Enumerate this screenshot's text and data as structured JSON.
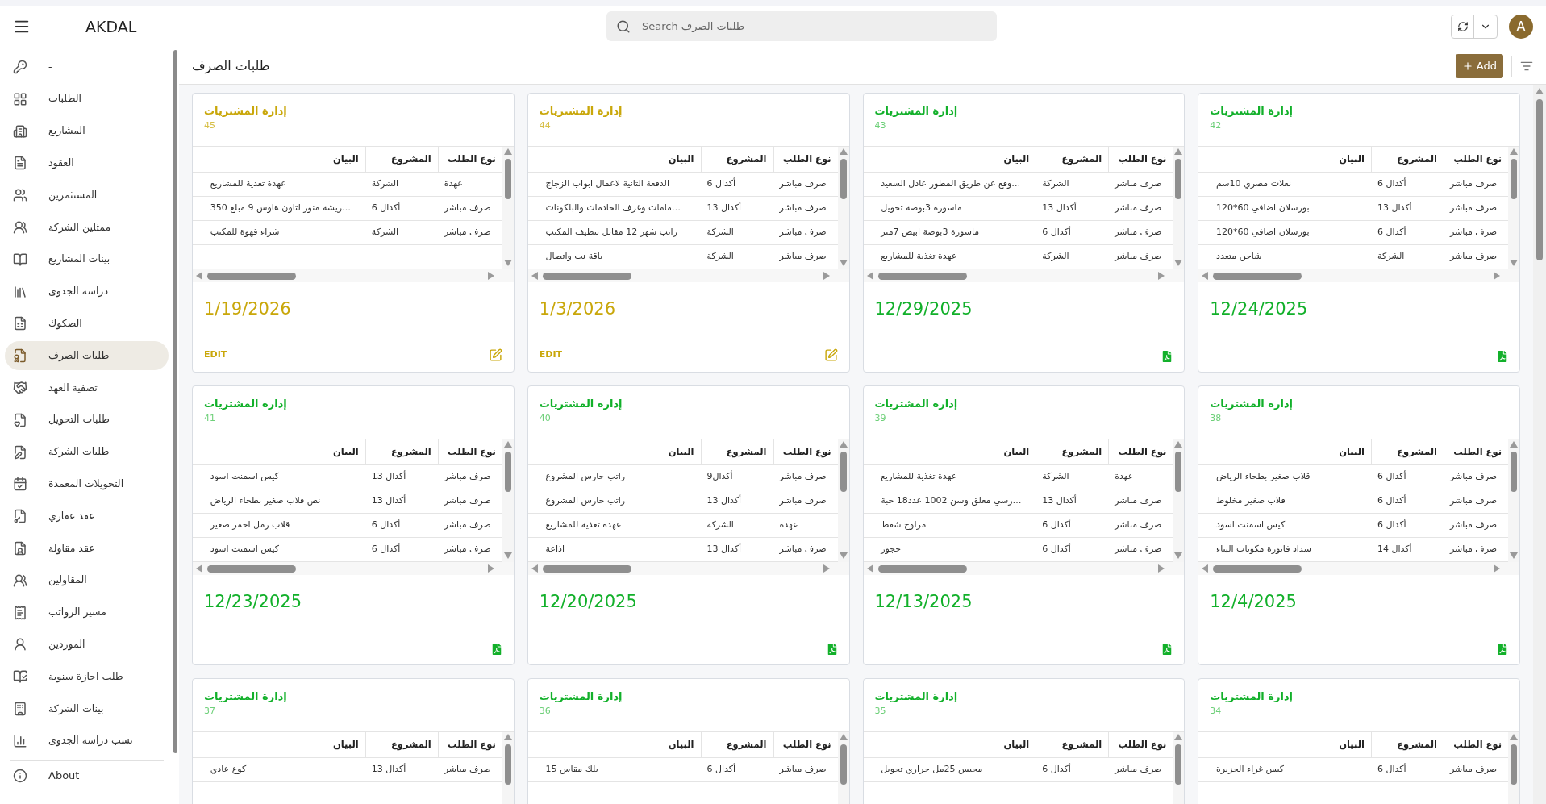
{
  "header": {
    "app_name": "AKDAL",
    "search": {
      "placeholder": "Search طلبات الصرف"
    },
    "avatar": "A"
  },
  "sidebar": {
    "items": [
      {
        "label": "-",
        "selected": false
      },
      {
        "label": "الطلبات",
        "selected": false
      },
      {
        "label": "المشاريع",
        "selected": false
      },
      {
        "label": "العقود",
        "selected": false
      },
      {
        "label": "المستثمرين",
        "selected": false
      },
      {
        "label": "ممثلين الشركة",
        "selected": false
      },
      {
        "label": "بينات المشاريع",
        "selected": false
      },
      {
        "label": "دراسة الجدوى",
        "selected": false
      },
      {
        "label": "الصكوك",
        "selected": false
      },
      {
        "label": "طلبات الصرف",
        "selected": true
      },
      {
        "label": "تصفية العهد",
        "selected": false
      },
      {
        "label": "طلبات التحويل",
        "selected": false
      },
      {
        "label": "طلبات الشركة",
        "selected": false
      },
      {
        "label": "التحويلات المعمدة",
        "selected": false
      },
      {
        "label": "عقد عقاري",
        "selected": false
      },
      {
        "label": "عقد مقاولة",
        "selected": false
      },
      {
        "label": "المقاولين",
        "selected": false
      },
      {
        "label": "مسير الرواتب",
        "selected": false
      },
      {
        "label": "الموردين",
        "selected": false
      },
      {
        "label": "طلب اجازة سنوية",
        "selected": false
      },
      {
        "label": "بينات الشركة",
        "selected": false
      },
      {
        "label": "نسب دراسة الجدوى",
        "selected": false
      }
    ],
    "footer_items": [
      {
        "label": "About"
      }
    ]
  },
  "page": {
    "title": "طلبات الصرف",
    "add_button": "Add"
  },
  "cards": [
    {
      "kind": "approved",
      "title": "إدارة المشتريات",
      "number": "42",
      "date": "12/24/2025",
      "columns": [
        "نوع الطلب",
        "المشروع",
        "البيان"
      ],
      "rows": [
        [
          "صرف مباشر",
          "أكدال 6",
          "نعلات مصري 10سم"
        ],
        [
          "صرف مباشر",
          "أكدال 13",
          "بورسلان اضافي 60*120"
        ],
        [
          "صرف مباشر",
          "أكدال 6",
          "بورسلان اضافي 60*120"
        ],
        [
          "صرف مباشر",
          "الشركة",
          "شاحن متعدد"
        ]
      ]
    },
    {
      "kind": "approved",
      "title": "إدارة المشتريات",
      "number": "43",
      "date": "12/29/2025",
      "columns": [
        "نوع الطلب",
        "المشروع",
        "البيان"
      ],
      "rows": [
        [
          "صرف مباشر",
          "الشركة",
          "…وقع عن طريق المطور عادل السعيد"
        ],
        [
          "صرف مباشر",
          "أكدال 13",
          "ماسورة 3بوصة تحويل"
        ],
        [
          "صرف مباشر",
          "أكدال 6",
          "ماسورة 3بوصة ابيض 7متر"
        ],
        [
          "صرف مباشر",
          "الشركة",
          "عهدة تغذية للمشاريع"
        ]
      ]
    },
    {
      "kind": "editable",
      "title": "إدارة المشتريات",
      "number": "44",
      "date": "1/3/2026",
      "edit_label": "EDIT",
      "columns": [
        "نوع الطلب",
        "المشروع",
        "البيان"
      ],
      "rows": [
        [
          "صرف مباشر",
          "أكدال 6",
          "الدفعة الثانية لاعمال ابواب الزجاج"
        ],
        [
          "صرف مباشر",
          "أكدال 13",
          "…مامات وغرف الخادمات والبلكونات"
        ],
        [
          "صرف مباشر",
          "الشركة",
          "راتب شهر 12 مقابل تنظيف المكتب"
        ],
        [
          "صرف مباشر",
          "الشركة",
          "باقة نت واتصال"
        ]
      ]
    },
    {
      "kind": "editable",
      "title": "إدارة المشتريات",
      "number": "45",
      "date": "1/19/2026",
      "edit_label": "EDIT",
      "columns": [
        "نوع الطلب",
        "المشروع",
        "البيان"
      ],
      "rows": [
        [
          "عهدة",
          "الشركة",
          "عهدة تغذية للمشاريع"
        ],
        [
          "صرف مباشر",
          "أكدال 6",
          "…ريشة منور لتاون هاوس 9 مبلغ 350"
        ],
        [
          "صرف مباشر",
          "الشركة",
          "شراء قهوة للمكتب"
        ]
      ]
    },
    {
      "kind": "approved",
      "title": "إدارة المشتريات",
      "number": "38",
      "date": "12/4/2025",
      "columns": [
        "نوع الطلب",
        "المشروع",
        "البيان"
      ],
      "rows": [
        [
          "صرف مباشر",
          "أكدال 6",
          "قلاب صغير بطحاء الرياض"
        ],
        [
          "صرف مباشر",
          "أكدال 6",
          "قلاب صغير مخلوط"
        ],
        [
          "صرف مباشر",
          "أكدال 6",
          "كيس اسمنت اسود"
        ],
        [
          "صرف مباشر",
          "أكدال 14",
          "سداد فاتورة مكونات البناء"
        ]
      ]
    },
    {
      "kind": "approved",
      "title": "إدارة المشتريات",
      "number": "39",
      "date": "12/13/2025",
      "columns": [
        "نوع الطلب",
        "المشروع",
        "البيان"
      ],
      "rows": [
        [
          "عهدة",
          "الشركة",
          "عهدة تغذية للمشاريع"
        ],
        [
          "صرف مباشر",
          "أكدال 13",
          "…رسي معلق وسن 1002 عدد18 حبة"
        ],
        [
          "صرف مباشر",
          "أكدال 6",
          "مراوح شفط"
        ],
        [
          "صرف مباشر",
          "أكدال 6",
          "حجور"
        ]
      ]
    },
    {
      "kind": "approved",
      "title": "إدارة المشتريات",
      "number": "40",
      "date": "12/20/2025",
      "columns": [
        "نوع الطلب",
        "المشروع",
        "البيان"
      ],
      "rows": [
        [
          "صرف مباشر",
          "أكدال9",
          "راتب حارس المشروع"
        ],
        [
          "صرف مباشر",
          "أكدال 13",
          "راتب حارس المشروع"
        ],
        [
          "عهدة",
          "الشركة",
          "عهدة تغذية للمشاريع"
        ],
        [
          "صرف مباشر",
          "أكدال 13",
          "اذاعة"
        ]
      ]
    },
    {
      "kind": "approved",
      "title": "إدارة المشتريات",
      "number": "41",
      "date": "12/23/2025",
      "columns": [
        "نوع الطلب",
        "المشروع",
        "البيان"
      ],
      "rows": [
        [
          "صرف مباشر",
          "أكدال 13",
          "كيس اسمنت اسود"
        ],
        [
          "صرف مباشر",
          "أكدال 13",
          "نص قلاب صغير بطحاء الرياض"
        ],
        [
          "صرف مباشر",
          "أكدال 6",
          "قلاب رمل احمر صغير"
        ],
        [
          "صرف مباشر",
          "أكدال 6",
          "كيس اسمنت اسود"
        ]
      ]
    },
    {
      "kind": "approved",
      "title": "إدارة المشتريات",
      "number": "34",
      "columns": [
        "نوع الطلب",
        "المشروع",
        "البيان"
      ],
      "rows": [
        [
          "صرف مباشر",
          "أكدال 6",
          "كيس غراء الجزيرة"
        ]
      ]
    },
    {
      "kind": "approved",
      "title": "إدارة المشتريات",
      "number": "35",
      "columns": [
        "نوع الطلب",
        "المشروع",
        "البيان"
      ],
      "rows": [
        [
          "صرف مباشر",
          "أكدال 6",
          "محبس 25مل حراري تحويل"
        ]
      ]
    },
    {
      "kind": "approved",
      "title": "إدارة المشتريات",
      "number": "36",
      "columns": [
        "نوع الطلب",
        "المشروع",
        "البيان"
      ],
      "rows": [
        [
          "صرف مباشر",
          "أكدال 6",
          "بلك مقاس 15"
        ]
      ]
    },
    {
      "kind": "approved",
      "title": "إدارة المشتريات",
      "number": "37",
      "columns": [
        "نوع الطلب",
        "المشروع",
        "البيان"
      ],
      "rows": [
        [
          "صرف مباشر",
          "أكدال 13",
          "كوع عادي"
        ]
      ]
    }
  ]
}
